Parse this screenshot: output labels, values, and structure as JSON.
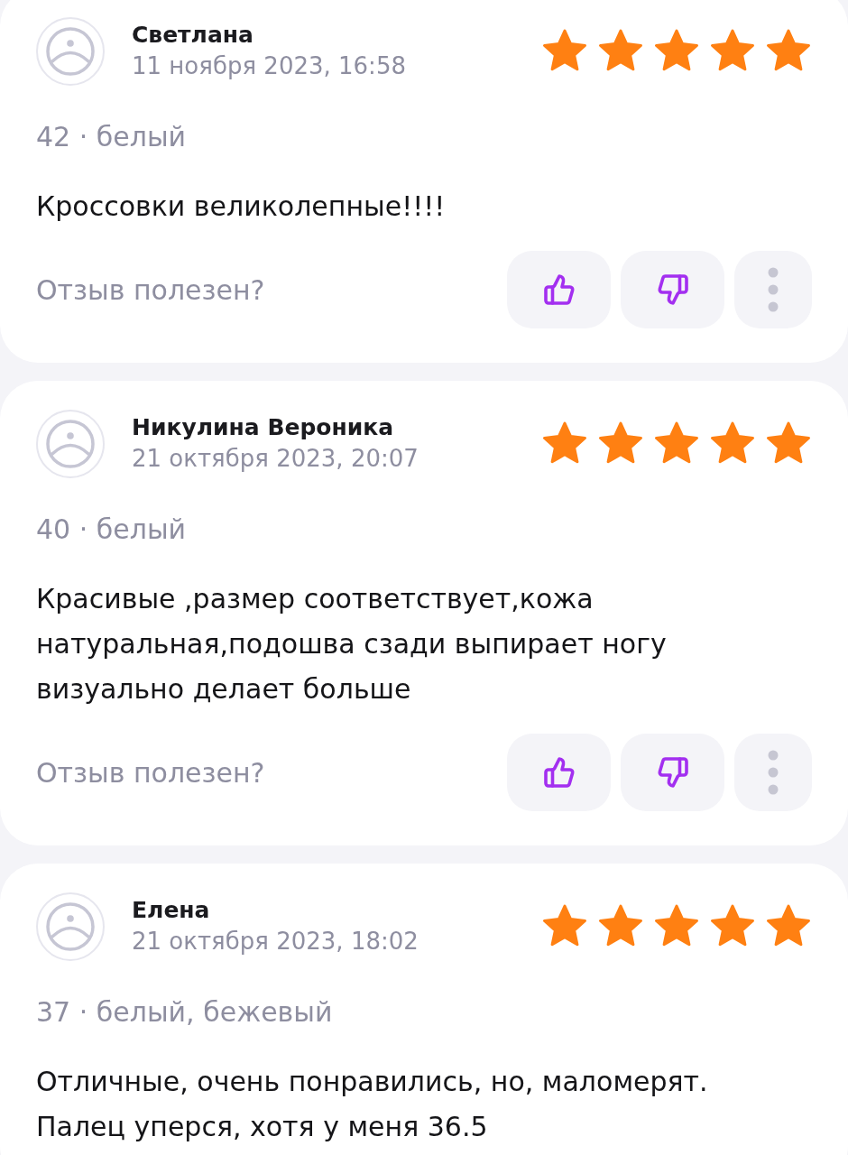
{
  "reviews": [
    {
      "author": "Светлана",
      "date": "11 ноября 2023, 16:58",
      "stars": 5,
      "details": "42 · белый",
      "text": "Кроссовки великолепные!!!!",
      "helpful_prompt": "Отзыв полезен?"
    },
    {
      "author": "Никулина Вероника",
      "date": "21 октября 2023, 20:07",
      "stars": 5,
      "details": "40 · белый",
      "text": "Красивые ,размер соответствует,кожа натуральная,подошва сзади выпирает ногу визуально делает больше",
      "helpful_prompt": "Отзыв полезен?"
    },
    {
      "author": "Елена",
      "date": "21 октября 2023, 18:02",
      "stars": 5,
      "details": "37 · белый, бежевый",
      "text": "Отличные, очень понравились, но, маломерят. Палец уперся, хотя у меня 36.5"
    }
  ]
}
